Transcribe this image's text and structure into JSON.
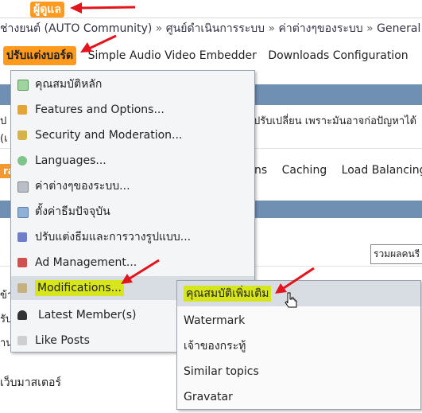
{
  "header": {
    "admin_badge": "ผู้ดูแล"
  },
  "breadcrumb": {
    "items": [
      "ช่างยนต์ (AUTO Community)",
      "ศูนย์ดำเนินการระบบ",
      "ค่าต่างๆของระบบ",
      "General"
    ],
    "separator": "»"
  },
  "menubar": {
    "active_label": "ปรับแต่งบอร์ด",
    "items": [
      "Simple Audio Video Embedder",
      "Downloads Configuration"
    ]
  },
  "background": {
    "warning_text": "ปรับเปลี่ยน เพราะมันอาจก่อปัญหาได้",
    "left_fragment_1": "ป",
    "left_fragment_2": "(เ",
    "orange_tab_fragment": "ra",
    "subnav": [
      "ns",
      "Caching",
      "Load Balancing"
    ],
    "select_value": "รวมผลคนรี",
    "row_fragment_1": "ข้า",
    "row_fragment_2": "รับ",
    "row_fragment_3": "าน",
    "webmaster_text": "เว็บมาสเตอร์"
  },
  "menu": {
    "items": [
      {
        "label": "คุณสมบัติหลัก",
        "icon": "checklist-icon"
      },
      {
        "label": "Features and Options...",
        "icon": "features-icon"
      },
      {
        "label": "Security and Moderation...",
        "icon": "lock-icon"
      },
      {
        "label": "Languages...",
        "icon": "globe-icon"
      },
      {
        "label": "ค่าต่างๆของระบบ...",
        "icon": "server-icon"
      },
      {
        "label": "ตั้งค่าธีมปัจจุบัน",
        "icon": "theme-icon"
      },
      {
        "label": "ปรับแต่งธีมและการวางรูปแบบ...",
        "icon": "brush-icon"
      },
      {
        "label": "Ad Management...",
        "icon": "ad-icon"
      },
      {
        "label": "Modifications...",
        "icon": "modifications-icon"
      },
      {
        "label": "Latest Member(s)",
        "icon": "user-icon"
      },
      {
        "label": "Like Posts",
        "icon": "like-icon"
      }
    ]
  },
  "submenu": {
    "items": [
      "คุณสมบัติเพิ่มเติม",
      "Watermark",
      "เจ้าของกระทู้",
      "Similar topics",
      "Gravatar"
    ]
  },
  "colors": {
    "highlight": "#d7e51c",
    "badge": "#ff9a1f",
    "arrow": "#e3141b"
  }
}
